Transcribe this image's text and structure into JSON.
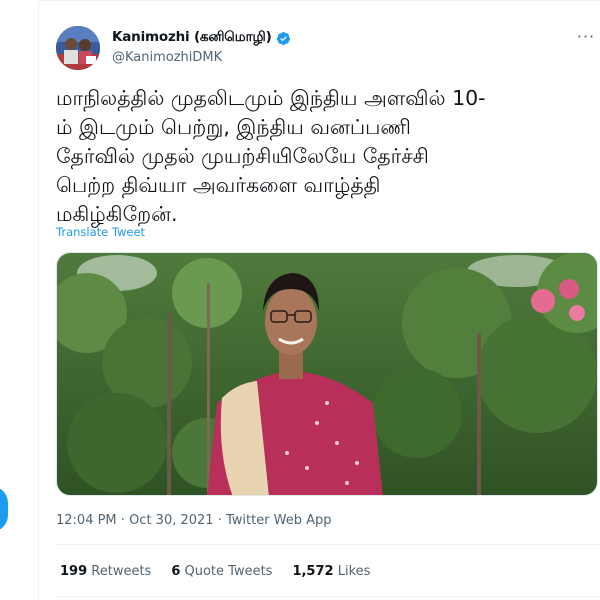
{
  "user": {
    "display_name": "Kanimozhi (கனிமொழி)",
    "handle": "@KanimozhiDMK",
    "verified": true,
    "avatar_icon": "user-avatar-photo"
  },
  "menu": {
    "more_icon": "more-horizontal-icon",
    "more_label": "···"
  },
  "tweet": {
    "lines": [
      "மாநிலத்தில் முதலிடமும் இந்திய அளவில் 10-",
      "ம் இடமும் பெற்று, இந்திய வனப்பணி",
      "தேர்வில் முதல் முயற்சியிலேயே தேர்ச்சி",
      "பெற்ற திவ்யா அவர்களை வாழ்த்தி",
      "மகிழ்கிறேன்."
    ],
    "translate_label": "Translate Tweet"
  },
  "media": {
    "type": "photo",
    "icon": "photo-of-woman-in-garden"
  },
  "meta": {
    "time": "12:04 PM",
    "separator": " · ",
    "date": "Oct 30, 2021",
    "source": "Twitter Web App"
  },
  "stats": {
    "retweets_count": "199",
    "retweets_label": " Retweets",
    "quotes_count": "6",
    "quotes_label": " Quote Tweets",
    "likes_count": "1,572",
    "likes_label": " Likes"
  },
  "colors": {
    "accent": "#1d9bf0",
    "text_primary": "#0f1419",
    "text_secondary": "#536471",
    "border": "#eff3f4"
  }
}
